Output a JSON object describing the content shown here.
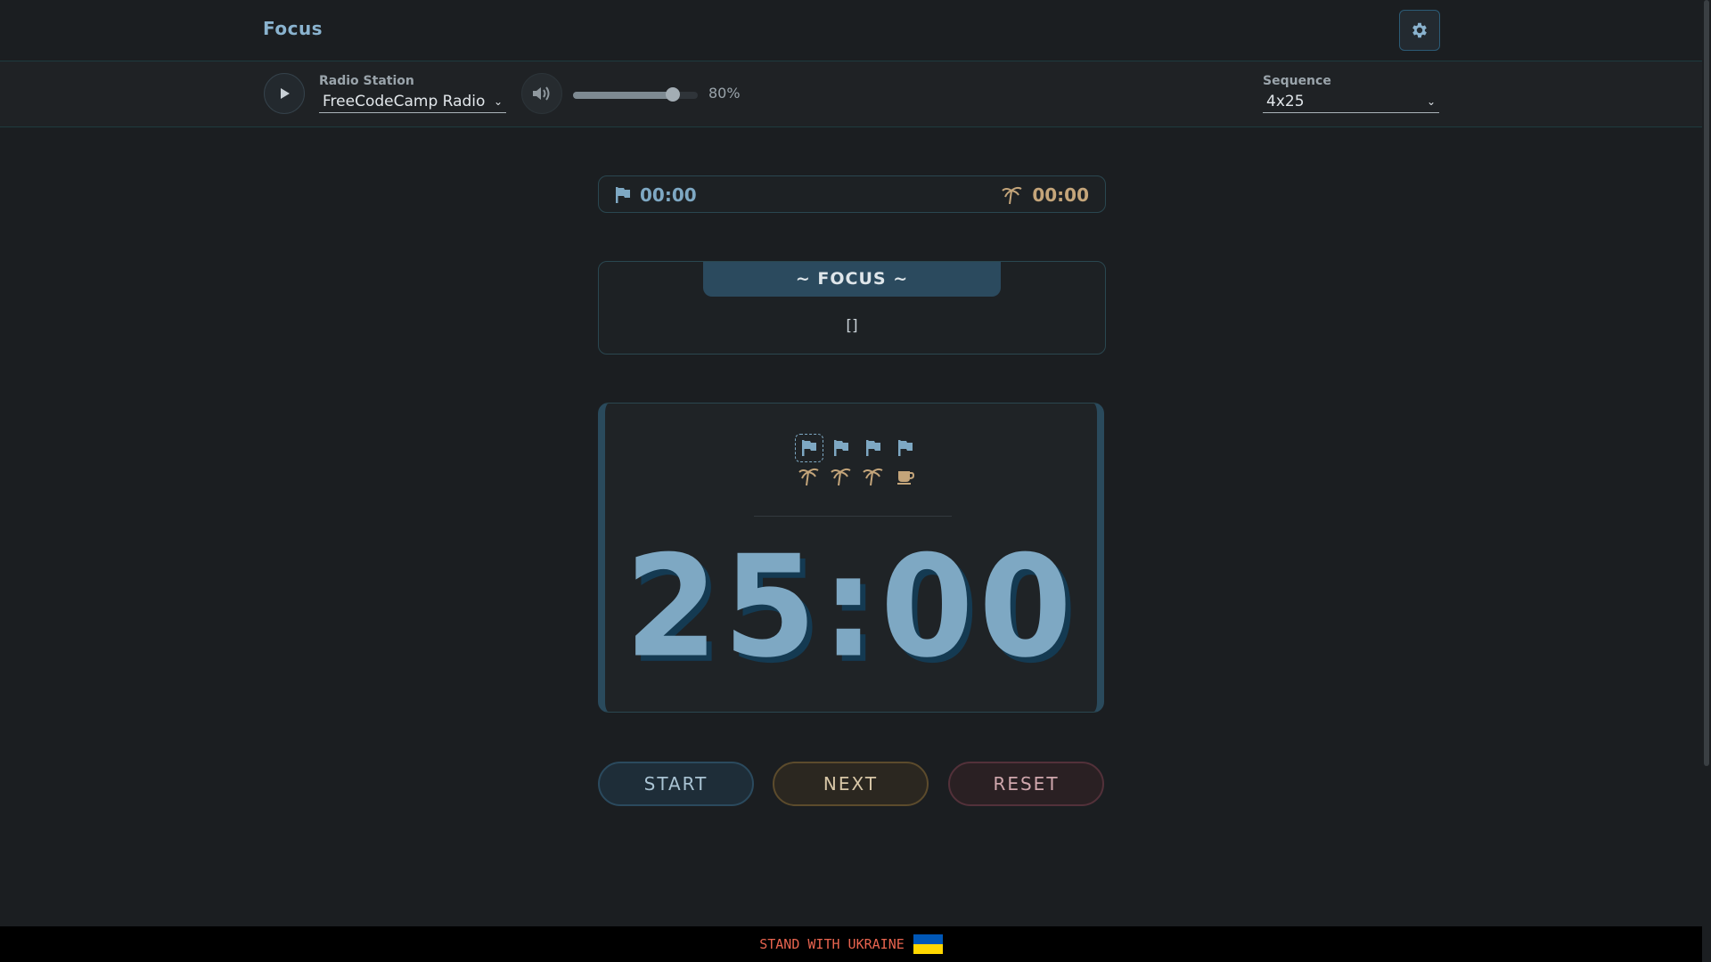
{
  "header": {
    "title": "Focus"
  },
  "radio": {
    "label": "Radio Station",
    "station": "FreeCodeCamp Radio",
    "volume_percent": 80,
    "volume_label": "80%"
  },
  "sequence": {
    "label": "Sequence",
    "value": "4x25"
  },
  "totals": {
    "focus_time": "00:00",
    "break_time": "00:00"
  },
  "focus_panel": {
    "title": "~ FOCUS ~",
    "text": "[]"
  },
  "timer": {
    "display": "25:00",
    "steps_focus": [
      "flag-icon",
      "flag-icon",
      "flag-icon",
      "flag-icon"
    ],
    "steps_break": [
      "palm-tree-icon",
      "palm-tree-icon",
      "palm-tree-icon",
      "coffee-icon"
    ],
    "active_step": 0
  },
  "actions": {
    "start": "START",
    "next": "NEXT",
    "reset": "RESET"
  },
  "footer": {
    "text": "STAND WITH UKRAINE"
  },
  "colors": {
    "focus_accent": "#7ea8c3",
    "break_accent": "#c4a57a",
    "reset_accent": "#d0a7ad",
    "footer_text": "#e8644f",
    "flag_blue": "#0057b7",
    "flag_yellow": "#ffd700"
  }
}
